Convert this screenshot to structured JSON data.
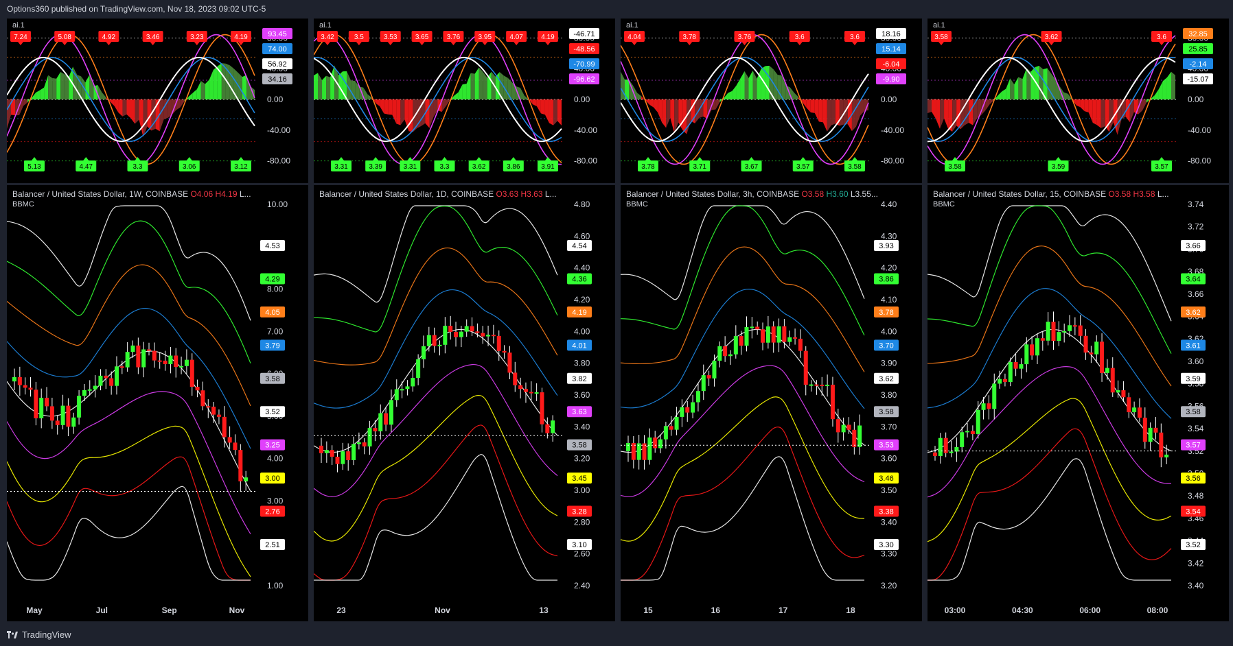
{
  "header": {
    "text": "Options360 published on TradingView.com, Nov 18, 2023 09:02 UTC-5"
  },
  "footer": {
    "brand": "TradingView"
  },
  "colors": {
    "green": "#33ff33",
    "red": "#ff1a1a",
    "orange": "#ff7f1a",
    "blue": "#1e88e5",
    "magenta": "#e040fb",
    "yellow": "#ffff00",
    "white": "#ffffff",
    "gray": "#b2b5be"
  },
  "panels": [
    {
      "osc": {
        "label": "ai.1",
        "ticks": [
          "80.00",
          "40.00",
          "0.00",
          "-40.00",
          "-80.00"
        ],
        "top_labels": [
          "7.24",
          "5.08",
          "4.92",
          "3.46",
          "3.23",
          "4.19"
        ],
        "bottom_labels": [
          "5.13",
          "4.47",
          "3.3",
          "3.06",
          "3.12"
        ],
        "badges": [
          {
            "v": "93.45",
            "c": "magenta"
          },
          {
            "v": "74.00",
            "c": "blue"
          },
          {
            "v": "56.92",
            "c": "white"
          },
          {
            "v": "34.16",
            "c": "gray"
          }
        ]
      },
      "main": {
        "title_pre": "Balancer / United States Dollar, 1W, COINBASE  ",
        "o": "O4.06",
        "h": "H4.19",
        "rest": " L...",
        "sub": "BBMC",
        "ticks": [
          "10.00",
          "9.00",
          "8.00",
          "7.00",
          "6.00",
          "5.00",
          "4.00",
          "3.00",
          "2.00",
          "1.00"
        ],
        "xlabels": [
          "May",
          "Jul",
          "Sep",
          "Nov"
        ],
        "badges": [
          {
            "v": "4.53",
            "c": "white"
          },
          {
            "v": "4.29",
            "c": "green"
          },
          {
            "v": "4.05",
            "c": "orange"
          },
          {
            "v": "3.79",
            "c": "blue"
          },
          {
            "v": "3.58",
            "c": "gray"
          },
          {
            "v": "3.52",
            "c": "white"
          },
          {
            "v": "3.25",
            "c": "magenta"
          },
          {
            "v": "3.00",
            "c": "yellow"
          },
          {
            "v": "2.76",
            "c": "red"
          },
          {
            "v": "2.51",
            "c": "white"
          }
        ]
      }
    },
    {
      "osc": {
        "label": "ai.1",
        "ticks": [
          "80.00",
          "40.00",
          "0.00",
          "-40.00",
          "-80.00"
        ],
        "top_labels": [
          "3.42",
          "3.5",
          "3.53",
          "3.65",
          "3.76",
          "3.95",
          "4.07",
          "4.19"
        ],
        "bottom_labels": [
          "3.31",
          "3.39",
          "3.31",
          "3.3",
          "3.62",
          "3.86",
          "3.91"
        ],
        "badges": [
          {
            "v": "-46.71",
            "c": "white"
          },
          {
            "v": "-48.56",
            "c": "red"
          },
          {
            "v": "-70.99",
            "c": "blue"
          },
          {
            "v": "-96.62",
            "c": "magenta"
          }
        ]
      },
      "main": {
        "title_pre": "Balancer / United States Dollar, 1D, COINBASE  ",
        "o": "O3.63",
        "h": "H3.63",
        "rest": " L...",
        "sub": "",
        "ticks": [
          "4.80",
          "4.60",
          "4.40",
          "4.20",
          "4.00",
          "3.80",
          "3.60",
          "3.40",
          "3.20",
          "3.00",
          "2.80",
          "2.60",
          "2.40"
        ],
        "xlabels": [
          "23",
          "Nov",
          "13"
        ],
        "badges": [
          {
            "v": "4.54",
            "c": "white"
          },
          {
            "v": "4.36",
            "c": "green"
          },
          {
            "v": "4.19",
            "c": "orange"
          },
          {
            "v": "4.01",
            "c": "blue"
          },
          {
            "v": "3.82",
            "c": "white"
          },
          {
            "v": "3.63",
            "c": "magenta"
          },
          {
            "v": "3.58",
            "c": "gray"
          },
          {
            "v": "3.45",
            "c": "yellow"
          },
          {
            "v": "3.28",
            "c": "red"
          },
          {
            "v": "3.10",
            "c": "white"
          }
        ]
      }
    },
    {
      "osc": {
        "label": "ai.1",
        "ticks": [
          "80.00",
          "40.00",
          "0.00",
          "-40.00",
          "-80.00"
        ],
        "top_labels": [
          "4.04",
          "3.78",
          "3.76",
          "3.6",
          "3.6"
        ],
        "bottom_labels": [
          "3.78",
          "3.71",
          "3.67",
          "3.57",
          "3.58"
        ],
        "badges": [
          {
            "v": "18.16",
            "c": "white"
          },
          {
            "v": "15.14",
            "c": "blue"
          },
          {
            "v": "-6.04",
            "c": "red"
          },
          {
            "v": "-9.90",
            "c": "magenta"
          }
        ]
      },
      "main": {
        "title_pre": "Balancer / United States Dollar, 3h, COINBASE  ",
        "o": "O3.58",
        "h": "H3.60",
        "rest": " L3.55...",
        "sub": "BBMC",
        "ticks": [
          "4.40",
          "4.30",
          "4.20",
          "4.10",
          "4.00",
          "3.90",
          "3.80",
          "3.70",
          "3.60",
          "3.50",
          "3.40",
          "3.30",
          "3.20"
        ],
        "xlabels": [
          "15",
          "16",
          "17",
          "18"
        ],
        "badges": [
          {
            "v": "3.93",
            "c": "white"
          },
          {
            "v": "3.86",
            "c": "green"
          },
          {
            "v": "3.78",
            "c": "orange"
          },
          {
            "v": "3.70",
            "c": "blue"
          },
          {
            "v": "3.62",
            "c": "white"
          },
          {
            "v": "3.58",
            "c": "gray"
          },
          {
            "v": "3.53",
            "c": "magenta"
          },
          {
            "v": "3.46",
            "c": "yellow"
          },
          {
            "v": "3.38",
            "c": "red"
          },
          {
            "v": "3.30",
            "c": "white"
          }
        ]
      }
    },
    {
      "osc": {
        "label": "ai.1",
        "ticks": [
          "80.00",
          "40.00",
          "0.00",
          "-40.00",
          "-80.00"
        ],
        "top_labels": [
          "3.58",
          "3.62",
          "3.6"
        ],
        "bottom_labels": [
          "3.58",
          "3.59",
          "3.57"
        ],
        "badges": [
          {
            "v": "32.85",
            "c": "orange"
          },
          {
            "v": "25.85",
            "c": "green"
          },
          {
            "v": "-2.14",
            "c": "blue"
          },
          {
            "v": "-15.07",
            "c": "white"
          }
        ]
      },
      "main": {
        "title_pre": "Balancer / United States Dollar, 15, COINBASE  ",
        "o": "O3.58",
        "h": "H3.58",
        "rest": " L...",
        "sub": "BBMC",
        "ticks": [
          "3.74",
          "3.72",
          "3.70",
          "3.68",
          "3.66",
          "3.64",
          "3.62",
          "3.60",
          "3.58",
          "3.56",
          "3.54",
          "3.52",
          "3.50",
          "3.48",
          "3.46",
          "3.44",
          "3.42",
          "3.40"
        ],
        "xlabels": [
          "03:00",
          "04:30",
          "06:00",
          "08:00"
        ],
        "badges": [
          {
            "v": "3.66",
            "c": "white"
          },
          {
            "v": "3.64",
            "c": "green"
          },
          {
            "v": "3.62",
            "c": "orange"
          },
          {
            "v": "3.61",
            "c": "blue"
          },
          {
            "v": "3.59",
            "c": "white"
          },
          {
            "v": "3.58",
            "c": "gray"
          },
          {
            "v": "3.57",
            "c": "magenta"
          },
          {
            "v": "3.56",
            "c": "yellow"
          },
          {
            "v": "3.54",
            "c": "red"
          },
          {
            "v": "3.52",
            "c": "white"
          }
        ]
      }
    }
  ]
}
